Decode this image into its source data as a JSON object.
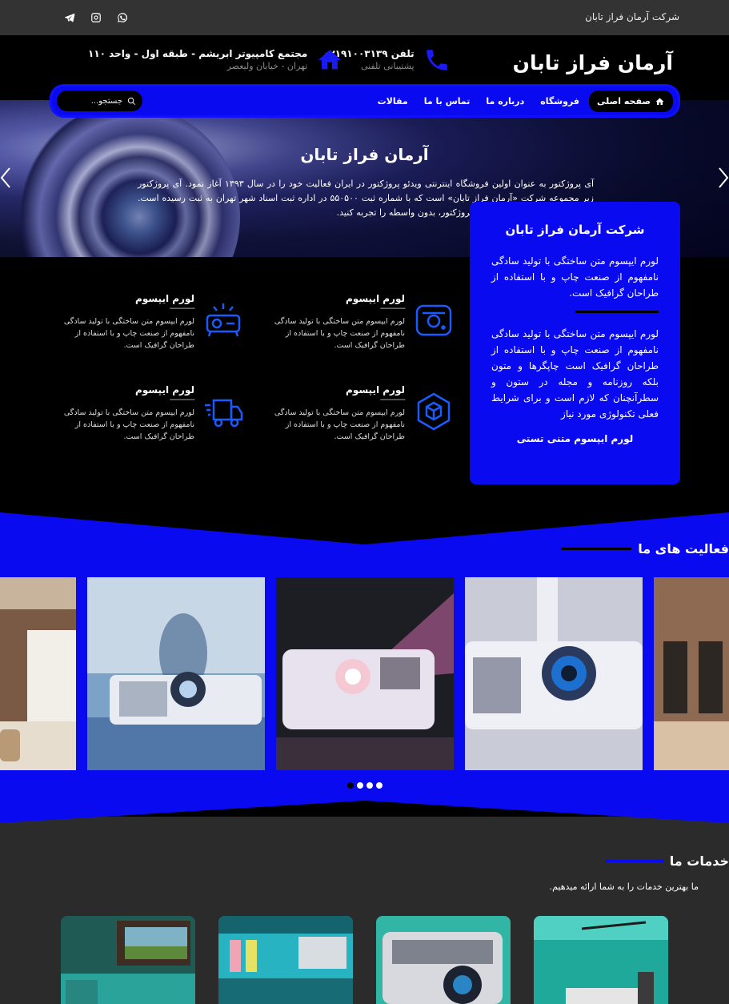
{
  "topbar": {
    "company": "شرکت آرمان فراز تابان",
    "socials": [
      "telegram-icon",
      "instagram-icon",
      "whatsapp-icon"
    ]
  },
  "header": {
    "logo_text": "آرمان فراز تابان",
    "phone": {
      "main": "تلفن ۰۲۱۹۱۰۰۳۱۳۹",
      "sub": "پشتیبانی تلفنی"
    },
    "address": {
      "main": "مجتمع کامپیوتر ابریشم - طبقه اول - واحد ۱۱۰",
      "sub": "تهران - خیابان ولیعصر"
    }
  },
  "nav": {
    "items": [
      "صفحه اصلی",
      "فروشگاه",
      "درباره ما",
      "تماس با ما",
      "مقالات"
    ],
    "search_placeholder": "جستجو..."
  },
  "hero": {
    "title": "آرمان فراز تابان",
    "description": "آی پروژکتور به عنوان اولین فروشگاه اینترنتی ویدئو پروژکتور در ایران فعالیت خود را در سال ۱۳۹۳ آغاز نمود. آی پروژکتور زیر مجموعه شرکت «آرمان فراز تابان» است که با شماره ثبت ۵۵۰۵۰۰ در اداره ثبت اسناد شهر تهران به ثبت رسیده است. در آی پروژکتور خرید ارزان ویدئو پروژکتور، بدون واسطه را تجربه کنید."
  },
  "infobox": {
    "title": "شرکت آرمان فراز تابان",
    "p1": "لورم ایپسوم متن ساختگی با تولید سادگی نامفهوم از صنعت چاپ و با استفاده از طراحان گرافیک است.",
    "p2": "لورم ایپسوم متن ساختگی با تولید سادگی نامفهوم از صنعت چاپ و با استفاده از طراحان گرافیک است چاپگرها و متون بلکه روزنامه و مجله در ستون و سطرآنچنان که لازم است و برای شرایط فعلی تکنولوژی مورد نیاز",
    "link": "لورم ایپسوم متنی تستی"
  },
  "features": [
    {
      "title": "لورم ایپسوم",
      "dash": "------------",
      "desc": "لورم ایپسوم متن ساختگی با تولید سادگی نامفهوم از صنعت چاپ و با استفاده از طراحان گرافیک است.",
      "icon": "camera-icon"
    },
    {
      "title": "لورم ایپسوم",
      "dash": "------------",
      "desc": "لورم ایپسوم متن ساختگی با تولید سادگی نامفهوم از صنعت چاپ و با استفاده از طراحان گرافیک است.",
      "icon": "projector-icon"
    },
    {
      "title": "لورم ایپسوم",
      "dash": "------------",
      "desc": "لورم ایپسوم متن ساختگی با تولید سادگی نامفهوم از صنعت چاپ و با استفاده از طراحان گرافیک است.",
      "icon": "box-icon"
    },
    {
      "title": "لورم ایپسوم",
      "dash": "------------",
      "desc": "لورم ایپسوم متن ساختگی با تولید سادگی نامفهوم از صنعت چاپ و با استفاده از طراحان گرافیک است.",
      "icon": "truck-icon"
    }
  ],
  "activities": {
    "title": "فعالیت های ما"
  },
  "services": {
    "title": "خدمات ما",
    "subtitle": "ما بهترین خدمات را به شما ارائه میدهیم."
  },
  "colors": {
    "accent": "#0a0af0",
    "topbar": "#333333",
    "icon_blue": "#1a5bff"
  }
}
